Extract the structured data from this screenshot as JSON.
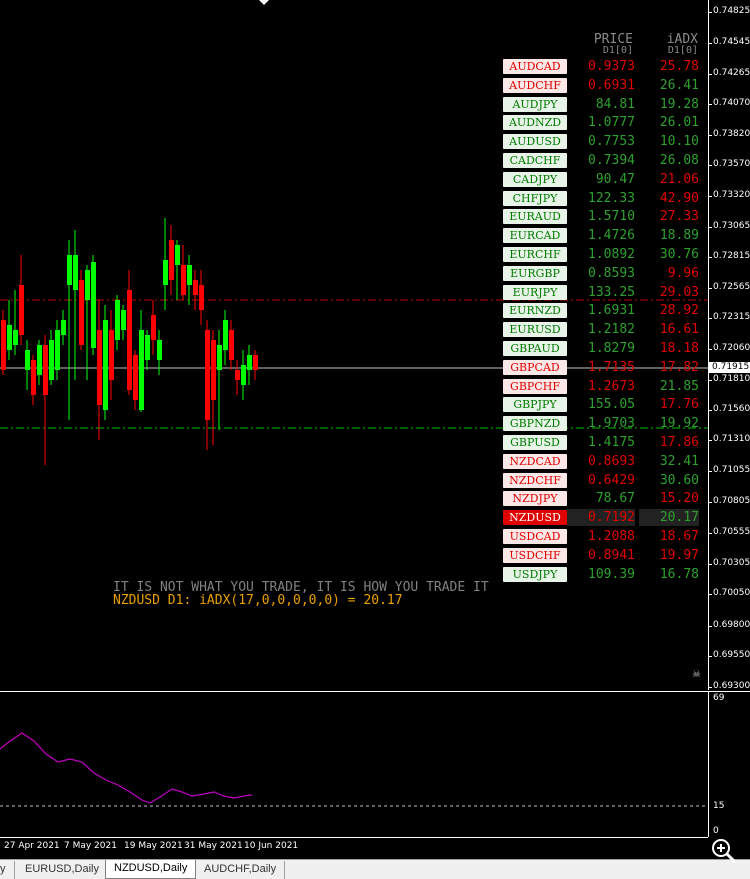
{
  "price_axis": {
    "labels": [
      "0.74825",
      "0.74545",
      "0.74265",
      "0.74070",
      "0.73820",
      "0.73570",
      "0.73320",
      "0.73065",
      "0.72815",
      "0.72565",
      "0.72315",
      "0.72060",
      "0.71810",
      "0.71560",
      "0.71310",
      "0.71055",
      "0.70805",
      "0.70555",
      "0.70305",
      "0.70050",
      "0.69800",
      "0.69550",
      "0.69300"
    ],
    "current": "0.71915"
  },
  "indicator_axis": {
    "top": "69",
    "mid": "15",
    "bottom": "0"
  },
  "time_axis": [
    "27 Apr 2021",
    "7 May 2021",
    "19 May 2021",
    "31 May 2021",
    "10 Jun 2021"
  ],
  "tabs": [
    "y",
    "EURUSD,Daily",
    "NZDUSD,Daily",
    "AUDCHF,Daily"
  ],
  "active_tab": "NZDUSD,Daily",
  "dashboard": {
    "header_price": "PRICE",
    "header_price_sub": "D1[0]",
    "header_adx": "iADX",
    "header_adx_sub": "D1[0]",
    "rows": [
      {
        "symbol": "AUDCAD",
        "price": "0.9373",
        "adx": "25.78",
        "dir": "bear",
        "pc": "red",
        "ac": "red"
      },
      {
        "symbol": "AUDCHF",
        "price": "0.6931",
        "adx": "26.41",
        "dir": "bear",
        "pc": "red",
        "ac": "green"
      },
      {
        "symbol": "AUDJPY",
        "price": "84.81",
        "adx": "19.28",
        "dir": "bull",
        "pc": "green",
        "ac": "green"
      },
      {
        "symbol": "AUDNZD",
        "price": "1.0777",
        "adx": "26.01",
        "dir": "bull",
        "pc": "green",
        "ac": "green"
      },
      {
        "symbol": "AUDUSD",
        "price": "0.7753",
        "adx": "10.10",
        "dir": "bull",
        "pc": "green",
        "ac": "green"
      },
      {
        "symbol": "CADCHF",
        "price": "0.7394",
        "adx": "26.08",
        "dir": "bull",
        "pc": "green",
        "ac": "green"
      },
      {
        "symbol": "CADJPY",
        "price": "90.47",
        "adx": "21.06",
        "dir": "bull",
        "pc": "green",
        "ac": "red"
      },
      {
        "symbol": "CHFJPY",
        "price": "122.33",
        "adx": "42.90",
        "dir": "bull",
        "pc": "green",
        "ac": "red"
      },
      {
        "symbol": "EURAUD",
        "price": "1.5710",
        "adx": "27.33",
        "dir": "bull",
        "pc": "green",
        "ac": "red"
      },
      {
        "symbol": "EURCAD",
        "price": "1.4726",
        "adx": "18.89",
        "dir": "bull",
        "pc": "green",
        "ac": "green"
      },
      {
        "symbol": "EURCHF",
        "price": "1.0892",
        "adx": "30.76",
        "dir": "bull",
        "pc": "green",
        "ac": "green"
      },
      {
        "symbol": "EURGBP",
        "price": "0.8593",
        "adx": "9.96",
        "dir": "bull",
        "pc": "green",
        "ac": "red"
      },
      {
        "symbol": "EURJPY",
        "price": "133.25",
        "adx": "29.03",
        "dir": "bull",
        "pc": "green",
        "ac": "red"
      },
      {
        "symbol": "EURNZD",
        "price": "1.6931",
        "adx": "28.92",
        "dir": "bull",
        "pc": "green",
        "ac": "red"
      },
      {
        "symbol": "EURUSD",
        "price": "1.2182",
        "adx": "16.61",
        "dir": "bull",
        "pc": "green",
        "ac": "red"
      },
      {
        "symbol": "GBPAUD",
        "price": "1.8279",
        "adx": "18.18",
        "dir": "bull",
        "pc": "green",
        "ac": "red"
      },
      {
        "symbol": "GBPCAD",
        "price": "1.7135",
        "adx": "17.82",
        "dir": "bear",
        "pc": "red",
        "ac": "red"
      },
      {
        "symbol": "GBPCHF",
        "price": "1.2673",
        "adx": "21.85",
        "dir": "bear",
        "pc": "red",
        "ac": "green"
      },
      {
        "symbol": "GBPJPY",
        "price": "155.05",
        "adx": "17.76",
        "dir": "bull",
        "pc": "green",
        "ac": "red"
      },
      {
        "symbol": "GBPNZD",
        "price": "1.9703",
        "adx": "19.92",
        "dir": "bull",
        "pc": "green",
        "ac": "green"
      },
      {
        "symbol": "GBPUSD",
        "price": "1.4175",
        "adx": "17.86",
        "dir": "bull",
        "pc": "green",
        "ac": "red"
      },
      {
        "symbol": "NZDCAD",
        "price": "0.8693",
        "adx": "32.41",
        "dir": "bear",
        "pc": "red",
        "ac": "green"
      },
      {
        "symbol": "NZDCHF",
        "price": "0.6429",
        "adx": "30.60",
        "dir": "bear",
        "pc": "red",
        "ac": "green"
      },
      {
        "symbol": "NZDJPY",
        "price": "78.67",
        "adx": "15.20",
        "dir": "bear",
        "pc": "green",
        "ac": "red"
      },
      {
        "symbol": "NZDUSD",
        "price": "0.7192",
        "adx": "20.17",
        "dir": "current",
        "pc": "red",
        "ac": "green"
      },
      {
        "symbol": "USDCAD",
        "price": "1.2088",
        "adx": "18.67",
        "dir": "bear",
        "pc": "red",
        "ac": "red"
      },
      {
        "symbol": "USDCHF",
        "price": "0.8941",
        "adx": "19.97",
        "dir": "bear",
        "pc": "red",
        "ac": "red"
      },
      {
        "symbol": "USDJPY",
        "price": "109.39",
        "adx": "16.78",
        "dir": "bull",
        "pc": "green",
        "ac": "green"
      }
    ]
  },
  "slogan": "IT IS NOT WHAT YOU TRADE, IT IS HOW YOU TRADE IT",
  "adx_caption": "NZDUSD D1: iADX(17,0,0,0,0,0) = 20.17",
  "colors": {
    "bull_candle": "#00ff00",
    "bear_candle": "#ff0000",
    "adx_line": "#c000c0",
    "upper_level": "#c00000",
    "lower_level": "#00c000",
    "caption": "#e8a000",
    "slogan": "#808080"
  }
}
